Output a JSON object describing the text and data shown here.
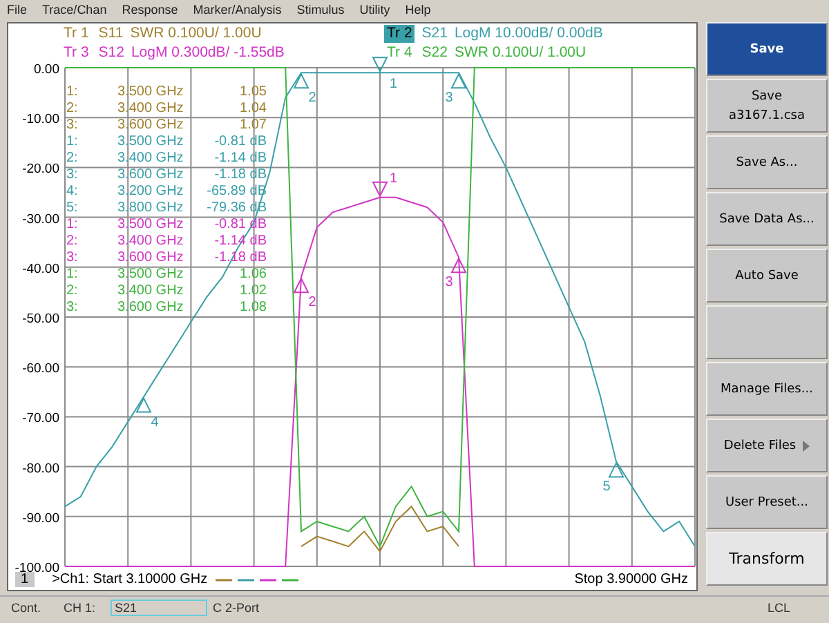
{
  "menu": [
    "File",
    "Trace/Chan",
    "Response",
    "Marker/Analysis",
    "Stimulus",
    "Utility",
    "Help"
  ],
  "traces": [
    {
      "label": "Tr 1",
      "format": "SWR 0.100U/  1.00U",
      "color": "#a0822e",
      "selected": false,
      "markers": [
        {
          "num": "1:",
          "freq": "3.500 GHz",
          "value": "1.05"
        },
        {
          "num": "2:",
          "freq": "3.400 GHz",
          "value": "1.04"
        },
        {
          "num": "3:",
          "freq": "3.600 GHz",
          "value": "1.07"
        }
      ]
    },
    {
      "label": "Tr 2",
      "format": "LogM 10.00dB/  0.00dB",
      "color": "#3aa0a8",
      "selected": true,
      "markers": [
        {
          "num": "1:",
          "freq": "3.500 GHz",
          "value": "-0.81 dB",
          "plot_label": "1"
        },
        {
          "num": "2:",
          "freq": "3.400 GHz",
          "value": "-1.14 dB",
          "plot_label": "2"
        },
        {
          "num": "3:",
          "freq": "3.600 GHz",
          "value": "-1.18 dB",
          "plot_label": "3"
        },
        {
          "num": "4:",
          "freq": "3.200 GHz",
          "value": "-65.89 dB",
          "plot_label": "4"
        },
        {
          "num": "5:",
          "freq": "3.800 GHz",
          "value": "-79.36 dB",
          "plot_label": "5"
        }
      ]
    },
    {
      "label": "Tr 3",
      "format": "LogM 0.300dB/  -1.55dB",
      "color": "#d335c4",
      "selected": false,
      "markers": [
        {
          "num": "1:",
          "freq": "3.500 GHz",
          "value": "-0.81 dB",
          "plot_label": "1"
        },
        {
          "num": "2:",
          "freq": "3.400 GHz",
          "value": "-1.14 dB",
          "plot_label": "2"
        },
        {
          "num": "3:",
          "freq": "3.600 GHz",
          "value": "-1.18 dB",
          "plot_label": "3"
        }
      ]
    },
    {
      "label": "Tr 4",
      "format": "SWR 0.100U/  1.00U",
      "color": "#3fb43f",
      "selected": false,
      "markers": [
        {
          "num": "1:",
          "freq": "3.500 GHz",
          "value": "1.06"
        },
        {
          "num": "2:",
          "freq": "3.400 GHz",
          "value": "1.02"
        },
        {
          "num": "3:",
          "freq": "3.600 GHz",
          "value": "1.08"
        }
      ]
    }
  ],
  "chart_data": {
    "type": "line",
    "ylim": [
      -100,
      0
    ],
    "grid": true,
    "yticks": [
      {
        "value": 0,
        "label": "0.00"
      },
      {
        "value": -10,
        "label": "-10.00"
      },
      {
        "value": -20,
        "label": "-20.00"
      },
      {
        "value": -30,
        "label": "-30.00"
      },
      {
        "value": -40,
        "label": "-40.00"
      },
      {
        "value": -50,
        "label": "-50.00"
      },
      {
        "value": -60,
        "label": "-60.00"
      },
      {
        "value": -70,
        "label": "-70.00"
      },
      {
        "value": -80,
        "label": "-80.00"
      },
      {
        "value": -90,
        "label": "-90.00"
      },
      {
        "value": -100,
        "label": "-100.00"
      }
    ],
    "categories": [
      null,
      null,
      null,
      null,
      null,
      null,
      null,
      null,
      null,
      null,
      null,
      null,
      null,
      null,
      null,
      null,
      null,
      null,
      null,
      null,
      null,
      null,
      null,
      null,
      null,
      null,
      null,
      null,
      null,
      null,
      null,
      null,
      null,
      null,
      null,
      null,
      null,
      null,
      null,
      null,
      null
    ],
    "series": [
      {
        "name": "S11",
        "color": "#a0822e",
        "values": [
          null,
          null,
          null,
          null,
          null,
          null,
          null,
          null,
          null,
          null,
          null,
          null,
          null,
          null,
          null,
          -96,
          -94,
          -95,
          -96,
          -93,
          -97,
          -91,
          -88,
          -93,
          -92,
          -96,
          null,
          null,
          null,
          null,
          null,
          null,
          null,
          null,
          null,
          null,
          null,
          null,
          null,
          null,
          null
        ]
      },
      {
        "name": "S21",
        "color": "#3aa0a8",
        "values": [
          -88,
          -86,
          -80,
          -76,
          -71,
          -66,
          -61,
          -56,
          -51,
          -46,
          -42,
          -36,
          -31,
          -21,
          -6,
          -1,
          -1,
          -1,
          -1,
          -1,
          -1,
          -1,
          -1,
          -1,
          -1,
          -1,
          -7,
          -14,
          -20,
          -27,
          -34,
          -41,
          -48,
          -55,
          -66,
          -79,
          -84,
          -89,
          -93,
          -91,
          -96
        ]
      },
      {
        "name": "S12",
        "color": "#d335c4",
        "values": [
          -100,
          -100,
          -100,
          -100,
          -100,
          -100,
          -100,
          -100,
          -100,
          -100,
          -100,
          -100,
          -100,
          -100,
          -100,
          -42,
          -32,
          -29,
          -28,
          -27,
          -26,
          -26,
          -27,
          -28,
          -31,
          -38,
          -100,
          -100,
          -100,
          -100,
          -100,
          -100,
          -100,
          -100,
          -100,
          -100,
          -100,
          -100,
          -100,
          -100,
          -100
        ]
      },
      {
        "name": "S22",
        "color": "#3fb43f",
        "values": [
          0,
          0,
          0,
          0,
          0,
          0,
          0,
          0,
          0,
          0,
          0,
          0,
          0,
          0,
          0,
          -93,
          -91,
          -92,
          -93,
          -90,
          -96,
          -88,
          -84,
          -90,
          -89,
          -93,
          0,
          0,
          0,
          0,
          0,
          0,
          0,
          0,
          0,
          0,
          0,
          0,
          0,
          0,
          0
        ]
      }
    ]
  },
  "channel": {
    "number": "1",
    "start": ">Ch1: Start  3.10000 GHz",
    "stop": "Stop  3.90000 GHz"
  },
  "softkeys": [
    {
      "label": "Save",
      "selected": true,
      "kind": "key"
    },
    {
      "label": "Save\na3167.1.csa",
      "selected": false,
      "kind": "key"
    },
    {
      "label": "Save As...",
      "selected": false,
      "kind": "key"
    },
    {
      "label": "Save Data As...",
      "selected": false,
      "kind": "key"
    },
    {
      "label": "Auto Save",
      "selected": false,
      "kind": "key"
    },
    {
      "selected": false,
      "kind": "key"
    },
    {
      "label": "Manage Files...",
      "selected": false,
      "kind": "key"
    },
    {
      "label": "Delete Files",
      "selected": false,
      "kind": "submenu"
    },
    {
      "label": "User Preset...",
      "selected": false,
      "kind": "key"
    },
    {
      "label": "Transform",
      "selected": false,
      "kind": "function"
    }
  ],
  "status_bar": {
    "mode": "Cont.",
    "channel": "CH 1:",
    "parameter": "S21",
    "cal": "C  2-Port",
    "remote": "LCL"
  }
}
